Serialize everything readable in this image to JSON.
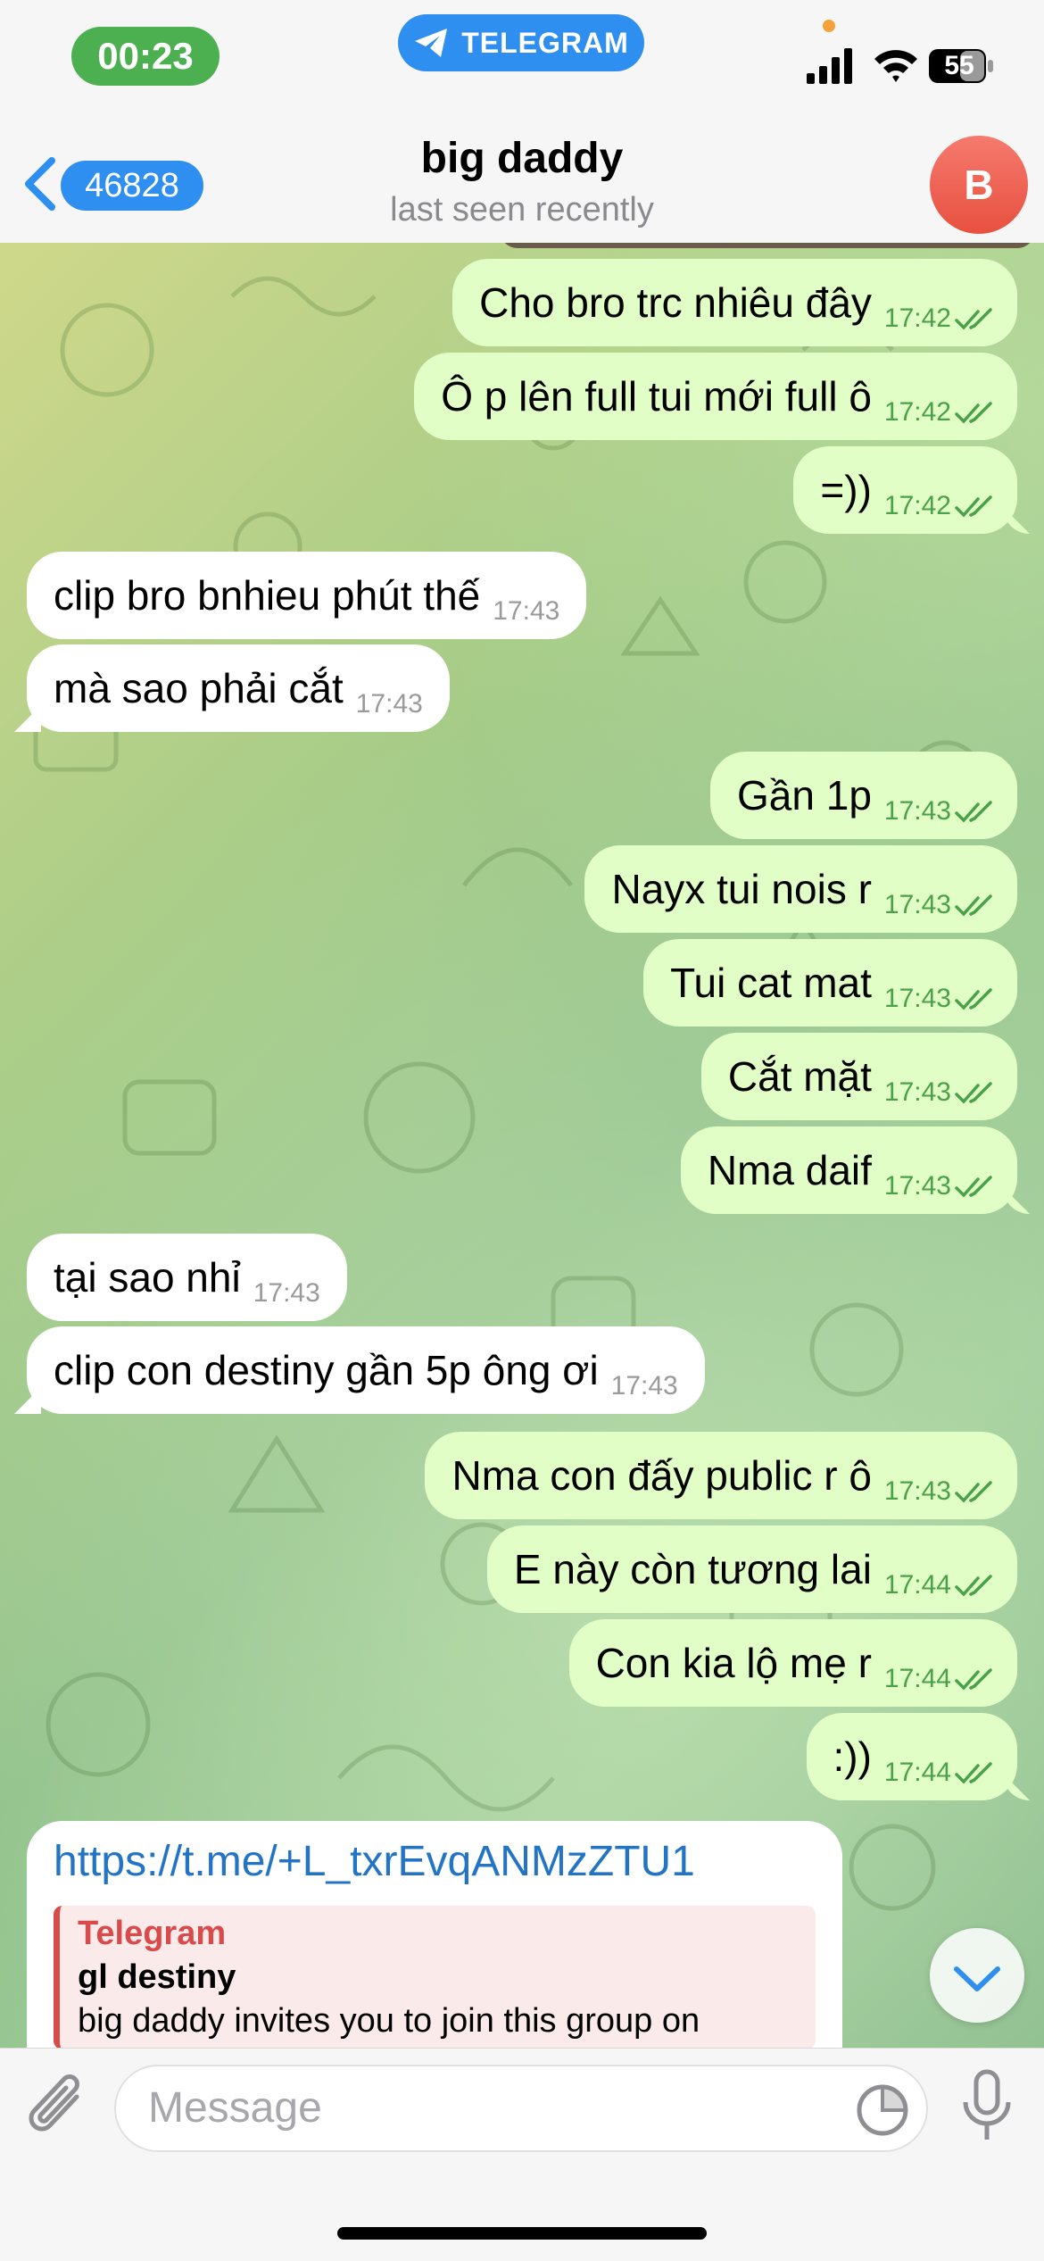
{
  "status": {
    "time": "00:23",
    "app_pill": "TELEGRAM",
    "battery": "55"
  },
  "header": {
    "back_count": "46828",
    "title": "big daddy",
    "subtitle": "last seen recently",
    "avatar_letter": "B"
  },
  "messages": [
    {
      "dir": "out",
      "text": "Cho bro trc nhiêu đây",
      "time": "17:42"
    },
    {
      "dir": "out",
      "text": "Ô p lên full tui mới full ô",
      "time": "17:42"
    },
    {
      "dir": "out",
      "text": "=))",
      "time": "17:42"
    },
    {
      "dir": "in",
      "text": "clip bro bnhieu phút thế",
      "time": "17:43"
    },
    {
      "dir": "in",
      "text": "mà sao phải cắt",
      "time": "17:43"
    },
    {
      "dir": "out",
      "text": "Gần 1p",
      "time": "17:43"
    },
    {
      "dir": "out",
      "text": "Nayx tui nois r",
      "time": "17:43"
    },
    {
      "dir": "out",
      "text": "Tui cat mat",
      "time": "17:43"
    },
    {
      "dir": "out",
      "text": "Cắt mặt",
      "time": "17:43"
    },
    {
      "dir": "out",
      "text": "Nma daif",
      "time": "17:43"
    },
    {
      "dir": "in",
      "text": "tại sao nhỉ",
      "time": "17:43"
    },
    {
      "dir": "in",
      "text": "clip con destiny gần 5p ông ơi",
      "time": "17:43"
    },
    {
      "dir": "out",
      "text": "Nma con đấy public r ô",
      "time": "17:43"
    },
    {
      "dir": "out",
      "text": "E này còn tương lai",
      "time": "17:44"
    },
    {
      "dir": "out",
      "text": "Con kia lộ mẹ r",
      "time": "17:44"
    },
    {
      "dir": "out",
      "text": ":))",
      "time": "17:44"
    }
  ],
  "link_message": {
    "url": "https://t.me/+L_txrEvqANMzZTU1",
    "preview_site": "Telegram",
    "preview_title": "gl destiny",
    "preview_desc": "big daddy invites you to join this group on"
  },
  "input": {
    "placeholder": "Message"
  },
  "colors": {
    "outgoing_bubble": "#e1fec6",
    "incoming_bubble": "#ffffff",
    "accent": "#2f8ff0",
    "avatar": "#e8503f",
    "time_pill": "#4caf50"
  }
}
